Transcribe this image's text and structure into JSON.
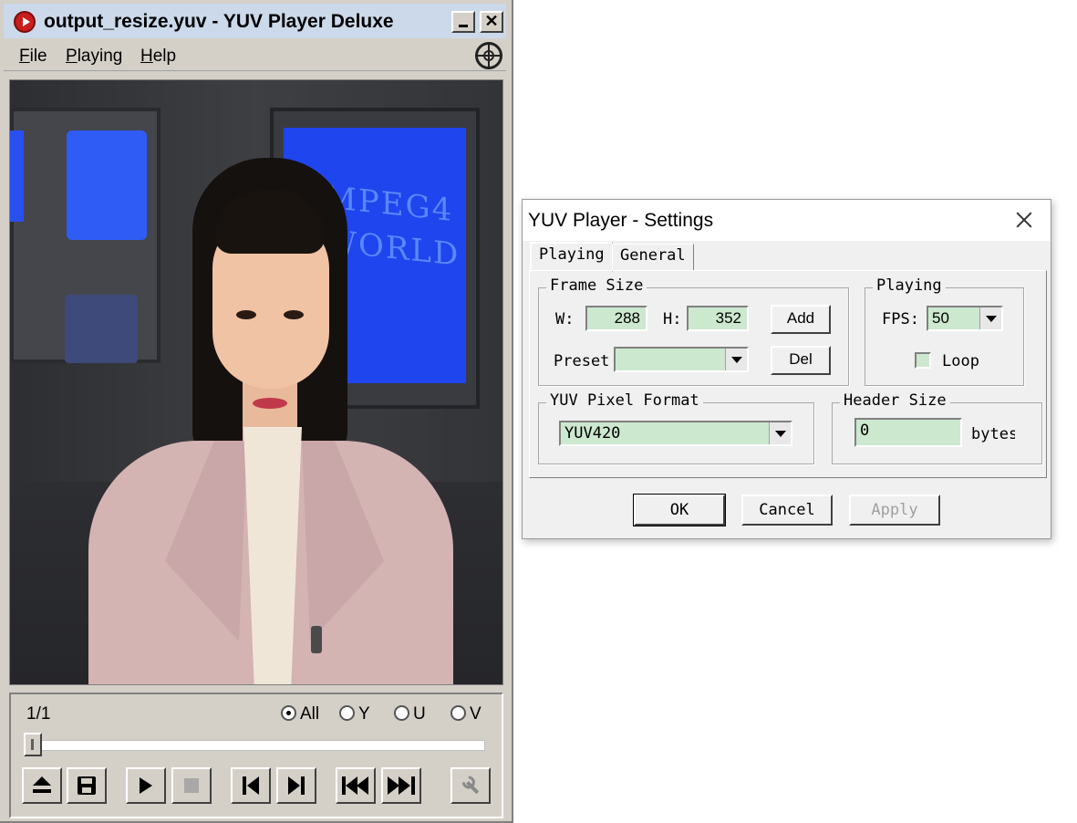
{
  "player": {
    "title": "output_resize.yuv - YUV Player Deluxe",
    "menu": [
      {
        "label": "File",
        "mnemonic": "F",
        "rest": "ile"
      },
      {
        "label": "Playing",
        "mnemonic": "P",
        "rest": "laying"
      },
      {
        "label": "Help",
        "mnemonic": "H",
        "rest": "elp"
      }
    ],
    "video_overlay_text": [
      "MPEG4",
      "WORLD"
    ],
    "frame_counter": "1/1",
    "channels": [
      {
        "label": "All",
        "checked": true
      },
      {
        "label": "Y",
        "checked": false
      },
      {
        "label": "U",
        "checked": false
      },
      {
        "label": "V",
        "checked": false
      }
    ],
    "seek_position": 0,
    "buttons": [
      "eject",
      "save",
      "play",
      "stop",
      "step-back",
      "step-forward",
      "go-first",
      "go-last",
      "settings"
    ]
  },
  "settings": {
    "title": "YUV Player - Settings",
    "tabs": [
      "Playing",
      "General"
    ],
    "active_tab": "Playing",
    "frame_size": {
      "group_label": "Frame Size",
      "w_label": "W:",
      "w_value": "288",
      "h_label": "H:",
      "h_value": "352",
      "add_label": "Add",
      "preset_label": "Preset",
      "preset_value": "",
      "del_label": "Del"
    },
    "playing": {
      "group_label": "Playing",
      "fps_label": "FPS:",
      "fps_value": "50",
      "loop_label": "Loop",
      "loop_checked": false
    },
    "pixel_format": {
      "group_label": "YUV Pixel Format",
      "value": "YUV420"
    },
    "header_size": {
      "group_label": "Header Size",
      "value": "0",
      "unit": "bytes"
    },
    "buttons": {
      "ok": "OK",
      "cancel": "Cancel",
      "apply": "Apply"
    }
  },
  "colors": {
    "field_bg": "#cce8cf",
    "player_bg": "#d4d0c8",
    "title_bar": "#cbd9ea",
    "app_icon": "#c81e1e"
  }
}
